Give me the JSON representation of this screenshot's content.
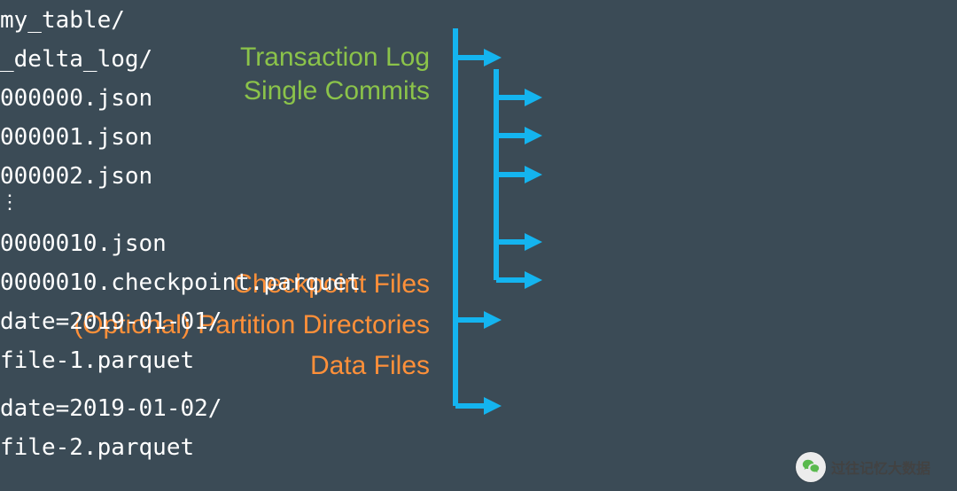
{
  "labels": {
    "transaction_log_1": "Transaction Log",
    "transaction_log_2": "Single Commits",
    "checkpoint_files": "Checkpoint Files",
    "partition_dirs": "(Optional) Partition Directories",
    "data_files": "Data Files"
  },
  "tree": {
    "root": "my_table/",
    "delta_log": "_delta_log/",
    "commits": [
      "000000.json",
      "000001.json",
      "000002.json"
    ],
    "ellipsis": "⋮",
    "commit_last": "0000010.json",
    "checkpoint": "0000010.checkpoint.parquet",
    "part1": "date=2019-01-01/",
    "file1": "file-1.parquet",
    "part2": "date=2019-01-02/",
    "file2": "file-2.parquet"
  },
  "colors": {
    "arrow": "#14b4ef",
    "label_green": "#8bc34a",
    "label_orange": "#ff9039",
    "text": "#ffffff",
    "bg": "#3b4b56"
  },
  "watermark": "过往记忆大数据"
}
